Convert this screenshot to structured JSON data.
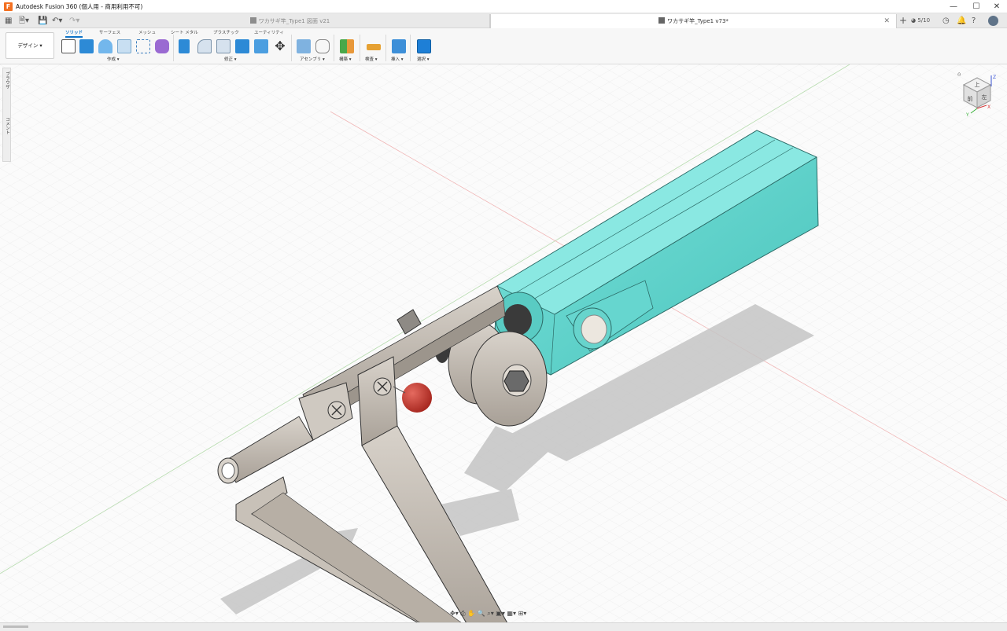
{
  "window": {
    "title": "Autodesk Fusion 360 (個人用 - 商用利用不可)",
    "minimize": "—",
    "maximize": "☐",
    "close": "✕"
  },
  "tabs": [
    {
      "label": "ワカサギ竿_Type1 図面 v21",
      "active": false
    },
    {
      "label": "ワカサギ竿_Type1 v73*",
      "active": true
    }
  ],
  "tabbar": {
    "job_count": "5/10",
    "new_tab": "+"
  },
  "workspace": {
    "label": "デザイン ▾"
  },
  "command_tabs": [
    "ソリッド",
    "サーフェス",
    "メッシュ",
    "シート メタル",
    "プラスチック",
    "ユーティリティ"
  ],
  "groups": {
    "create": "作成 ▾",
    "modify": "修正 ▾",
    "assemble": "アセンブリ ▾",
    "construct": "構築 ▾",
    "inspect": "検査 ▾",
    "insert": "挿入 ▾",
    "select": "選択 ▾"
  },
  "browser": {
    "label_top": "ブラウザ",
    "label_bottom": "コメント"
  },
  "viewcube": {
    "face_top": "上",
    "face_front": "前",
    "face_left": "左",
    "axis_z": "Z",
    "axis_x": "X",
    "axis_y": "Y"
  },
  "colors": {
    "accent": "#0d73c9",
    "handle": "#5fd3cc",
    "metal": "#bdb6ad",
    "knob": "#c9392f",
    "grid_minor": "#e2e2e2",
    "grid_major": "#d2d2d2"
  }
}
